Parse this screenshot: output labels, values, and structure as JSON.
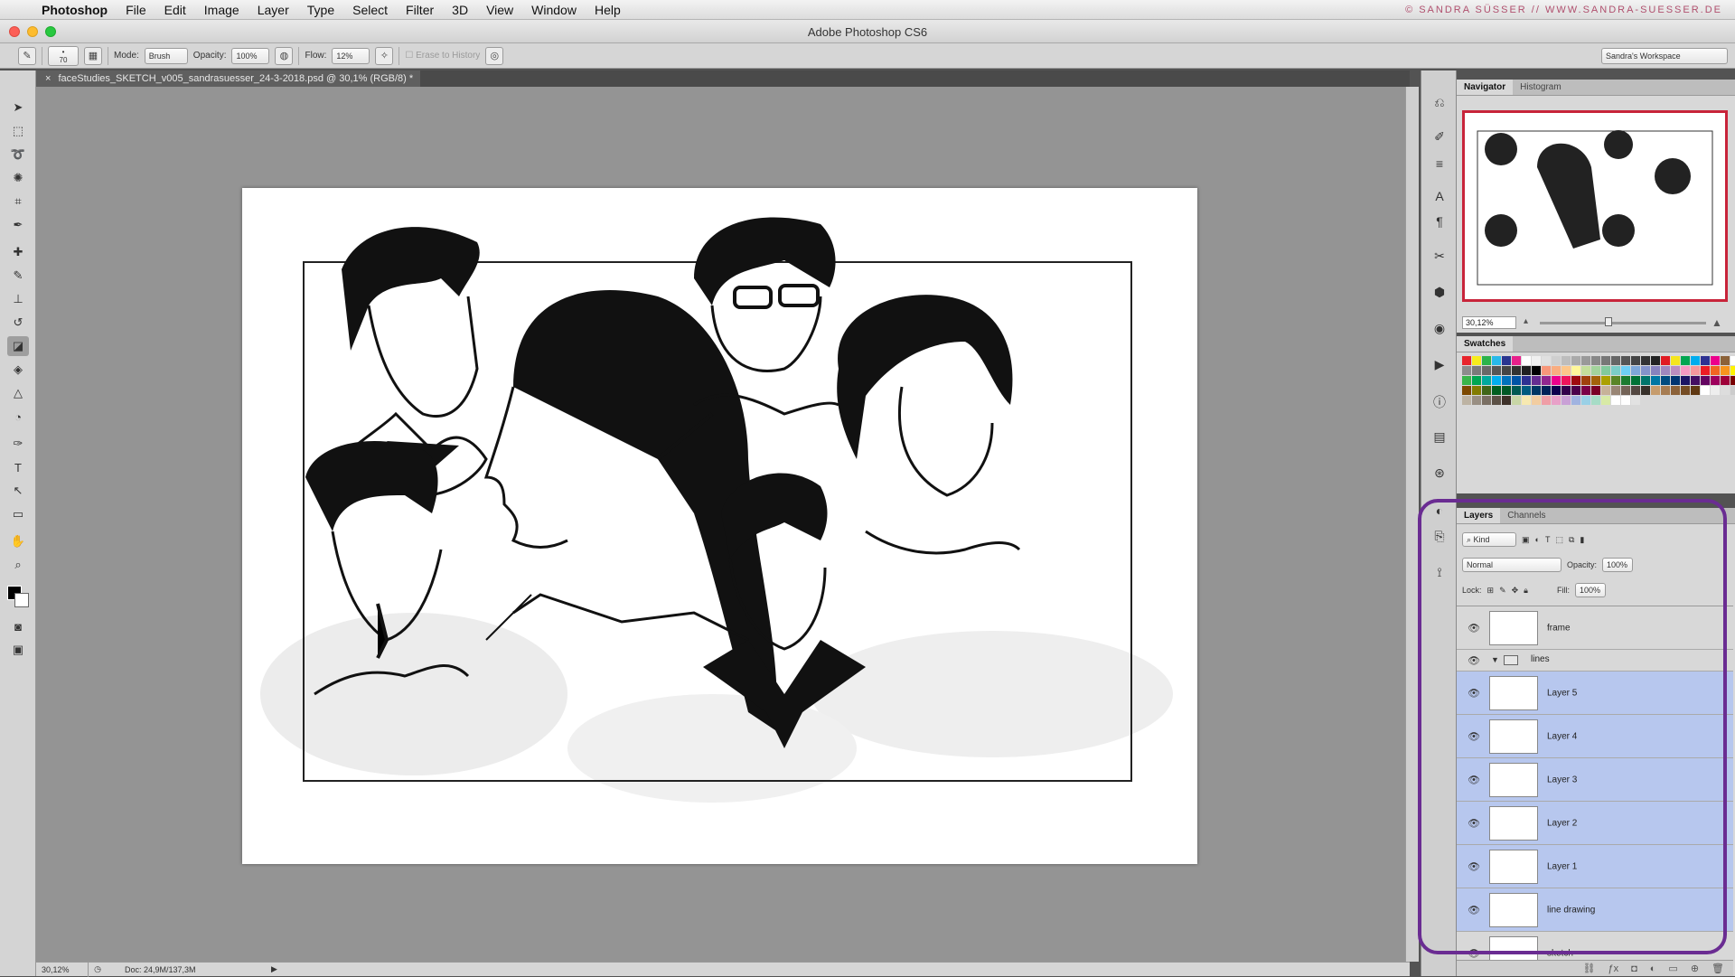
{
  "menubar": {
    "app": "Photoshop",
    "items": [
      "File",
      "Edit",
      "Image",
      "Layer",
      "Type",
      "Select",
      "Filter",
      "3D",
      "View",
      "Window",
      "Help"
    ],
    "credit": "© SANDRA SÜSSER // WWW.SANDRA-SUESSER.DE"
  },
  "window": {
    "title": "Adobe Photoshop CS6"
  },
  "options": {
    "brush_size": "70",
    "mode_label": "Mode:",
    "mode_value": "Brush",
    "opacity_label": "Opacity:",
    "opacity_value": "100%",
    "flow_label": "Flow:",
    "flow_value": "12%",
    "erase_history": "Erase to History",
    "workspace": "Sandra's Workspace"
  },
  "document": {
    "tab_title": "faceStudies_SKETCH_v005_sandrasuesser_24-3-2018.psd @ 30,1% (RGB/8) *",
    "close_glyph": "×"
  },
  "status": {
    "zoom": "30,12%",
    "doc_size": "Doc: 24,9M/137,3M"
  },
  "panels": {
    "navigator": {
      "tabs": [
        "Navigator",
        "Histogram"
      ],
      "zoom": "30,12%"
    },
    "swatches": {
      "title": "Swatches"
    },
    "layers": {
      "tabs": [
        "Layers",
        "Channels"
      ],
      "filter_kind": "Kind",
      "blend_mode": "Normal",
      "opacity_label": "Opacity:",
      "opacity_value": "100%",
      "lock_label": "Lock:",
      "fill_label": "Fill:",
      "fill_value": "100%",
      "items": [
        {
          "name": "frame",
          "type": "layer",
          "selected": false
        },
        {
          "name": "lines",
          "type": "group",
          "selected": false
        },
        {
          "name": "Layer 5",
          "type": "layer",
          "selected": true
        },
        {
          "name": "Layer 4",
          "type": "layer",
          "selected": true
        },
        {
          "name": "Layer 3",
          "type": "layer",
          "selected": true
        },
        {
          "name": "Layer 2",
          "type": "layer",
          "selected": true
        },
        {
          "name": "Layer 1",
          "type": "layer",
          "selected": true
        },
        {
          "name": "line drawing",
          "type": "layer",
          "selected": true
        },
        {
          "name": "sketch",
          "type": "layer",
          "selected": false
        }
      ]
    }
  },
  "colors": {
    "accent_frame": "#6a2c92",
    "navigator_frame": "#c8243a",
    "selected_layer": "#b7c7ee"
  }
}
